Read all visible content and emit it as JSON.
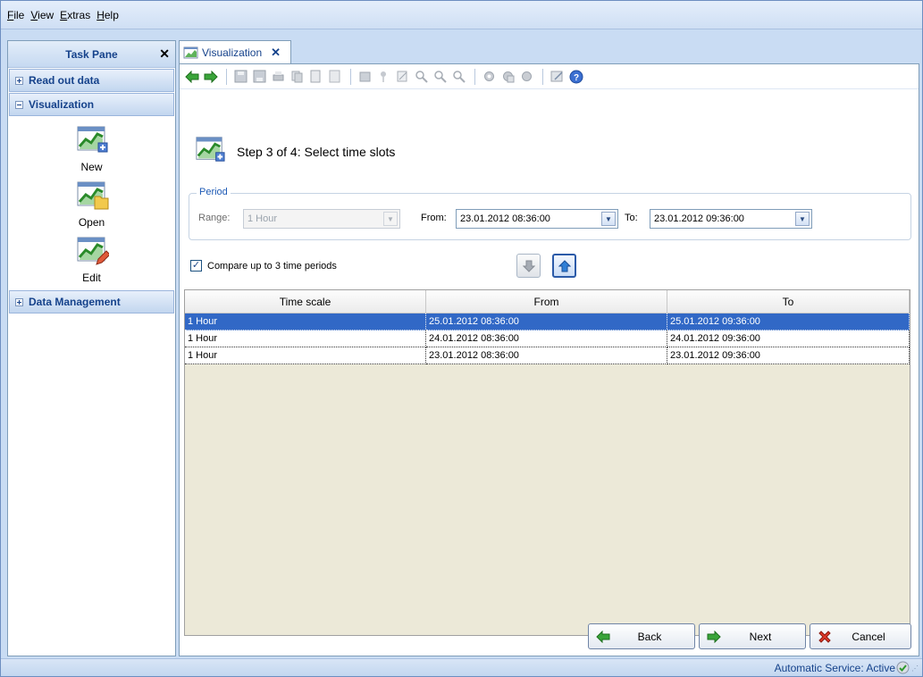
{
  "menu": {
    "items": [
      {
        "accel": "F",
        "rest": "ile"
      },
      {
        "accel": "V",
        "rest": "iew"
      },
      {
        "accel": "E",
        "rest": "xtras"
      },
      {
        "accel": "H",
        "rest": "elp"
      }
    ]
  },
  "taskpane": {
    "title": "Task Pane",
    "close_glyph": "✕",
    "sections": [
      "Read out data",
      "Visualization",
      "Data Management"
    ],
    "tools": [
      "New",
      "Open",
      "Edit"
    ]
  },
  "tab": {
    "label": "Visualization",
    "close_glyph": "✕"
  },
  "wizard": {
    "step_title": "Step 3 of 4: Select time slots",
    "period_legend": "Period",
    "range_label": "Range:",
    "range_value": "1 Hour",
    "from_label": "From:",
    "from_value": "23.01.2012 08:36:00",
    "to_label": "To:",
    "to_value": "23.01.2012 09:36:00",
    "compare_label": "Compare up to 3 time periods",
    "compare_checked": "✓"
  },
  "grid": {
    "columns": [
      "Time scale",
      "From",
      "To"
    ],
    "rows": [
      [
        "1 Hour",
        "25.01.2012 08:36:00",
        "25.01.2012 09:36:00"
      ],
      [
        "1 Hour",
        "24.01.2012 08:36:00",
        "24.01.2012 09:36:00"
      ],
      [
        "1 Hour",
        "23.01.2012 08:36:00",
        "23.01.2012 09:36:00"
      ]
    ],
    "selected_row": 0
  },
  "buttons": {
    "back": "Back",
    "next": "Next",
    "cancel": "Cancel"
  },
  "status": {
    "text": "Automatic Service: Active"
  },
  "colors": {
    "accent": "#15428b",
    "selection": "#3168c6",
    "frame": "#c9dcf3"
  }
}
